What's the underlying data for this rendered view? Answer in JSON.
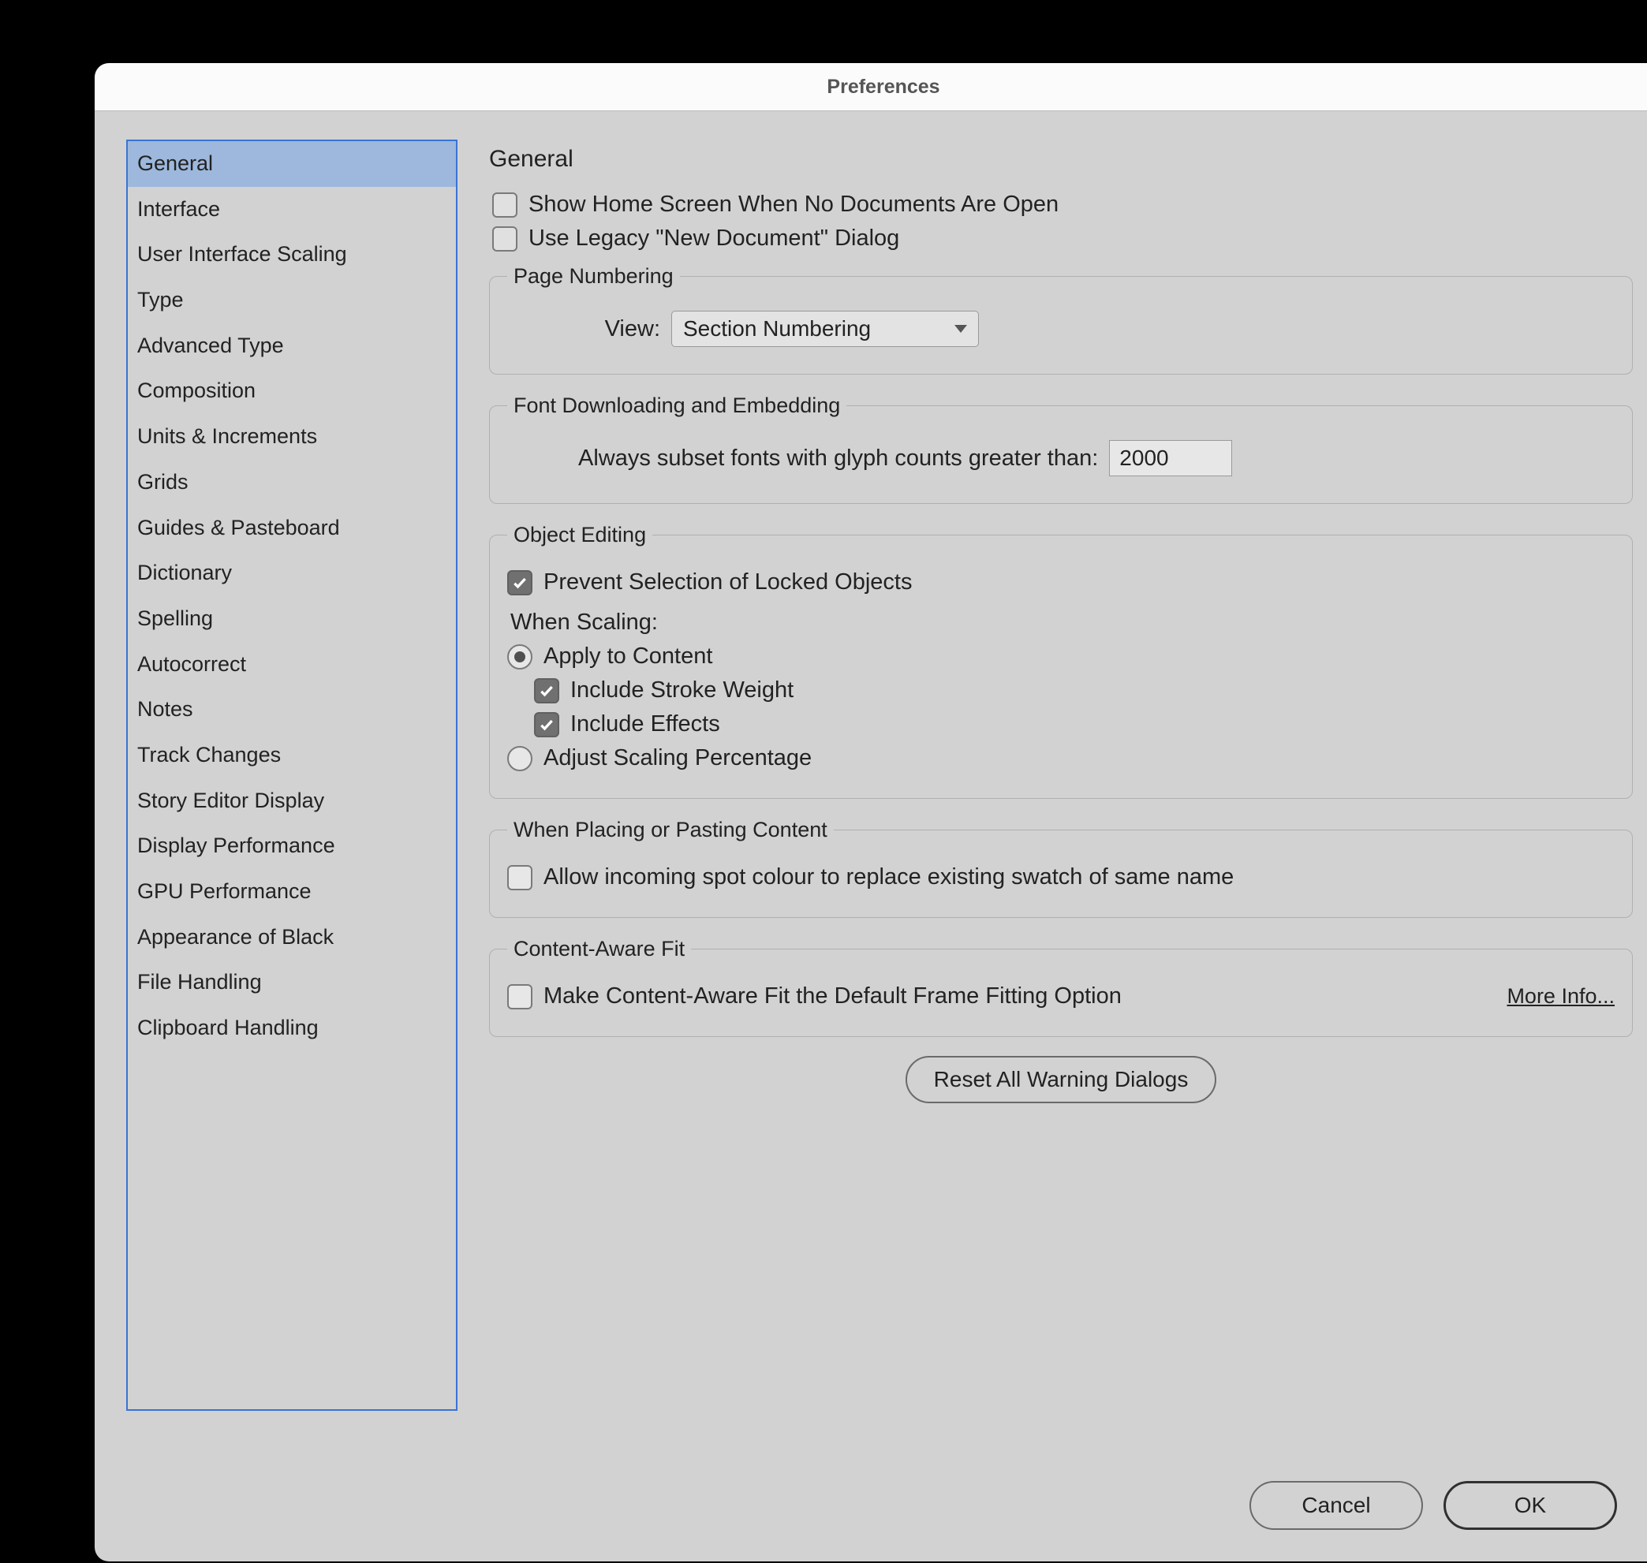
{
  "window": {
    "title": "Preferences"
  },
  "sidebar": {
    "selected": 0,
    "items": [
      "General",
      "Interface",
      "User Interface Scaling",
      "Type",
      "Advanced Type",
      "Composition",
      "Units & Increments",
      "Grids",
      "Guides & Pasteboard",
      "Dictionary",
      "Spelling",
      "Autocorrect",
      "Notes",
      "Track Changes",
      "Story Editor Display",
      "Display Performance",
      "GPU Performance",
      "Appearance of Black",
      "File Handling",
      "Clipboard Handling"
    ]
  },
  "main": {
    "heading": "General",
    "showHome": {
      "label": "Show Home Screen When No Documents Are Open",
      "checked": false
    },
    "legacyNewDoc": {
      "label": "Use Legacy \"New Document\" Dialog",
      "checked": false
    },
    "pageNumbering": {
      "legend": "Page Numbering",
      "viewLabel": "View:",
      "viewValue": "Section Numbering"
    },
    "fontDownload": {
      "legend": "Font Downloading and Embedding",
      "subsetLabel": "Always subset fonts with glyph counts greater than:",
      "subsetValue": "2000"
    },
    "objectEditing": {
      "legend": "Object Editing",
      "preventLocked": {
        "label": "Prevent Selection of Locked Objects",
        "checked": true
      },
      "whenScalingLabel": "When Scaling:",
      "applyToContent": {
        "label": "Apply to Content",
        "selected": true
      },
      "includeStroke": {
        "label": "Include Stroke Weight",
        "checked": true
      },
      "includeEffects": {
        "label": "Include Effects",
        "checked": true
      },
      "adjustPercentage": {
        "label": "Adjust Scaling Percentage",
        "selected": false
      }
    },
    "placing": {
      "legend": "When Placing or Pasting Content",
      "allowSpot": {
        "label": "Allow incoming spot colour to replace existing swatch of same name",
        "checked": false
      }
    },
    "contentAware": {
      "legend": "Content-Aware Fit",
      "makeDefault": {
        "label": "Make Content-Aware Fit the Default Frame Fitting Option",
        "checked": false
      },
      "moreInfo": "More Info..."
    },
    "resetButton": "Reset All Warning Dialogs"
  },
  "footer": {
    "cancel": "Cancel",
    "ok": "OK"
  }
}
